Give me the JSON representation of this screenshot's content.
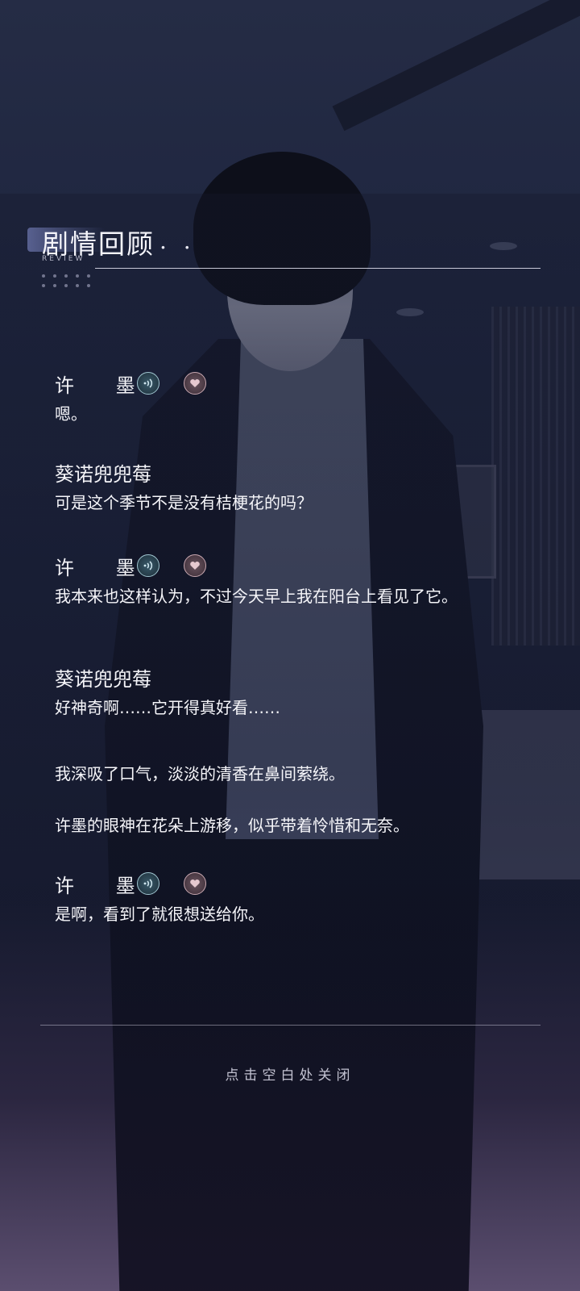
{
  "header": {
    "title": "剧情回顾",
    "title_dots": ". .",
    "subtitle": "REVIEW"
  },
  "dialogue": [
    {
      "speaker": "许 墨",
      "text": "嗯。",
      "has_voice": true,
      "has_like": true,
      "voice_icon": "sound-wave-icon",
      "like_icon": "heart-icon"
    },
    {
      "speaker": "葵诺兜兜莓",
      "text": "可是这个季节不是没有桔梗花的吗？",
      "has_voice": false,
      "has_like": false
    },
    {
      "speaker": "许 墨",
      "text": "我本来也这样认为，不过今天早上我在阳台上看见了它。",
      "has_voice": true,
      "has_like": true
    },
    {
      "speaker": "葵诺兜兜莓",
      "text": "好神奇啊……它开得真好看……",
      "has_voice": false,
      "has_like": false
    }
  ],
  "narration": [
    "我深吸了口气，淡淡的清香在鼻间萦绕。",
    "许墨的眼神在花朵上游移，似乎带着怜惜和无奈。"
  ],
  "last_line": {
    "speaker": "许 墨",
    "text": "是啊，看到了就很想送给你。"
  },
  "footer": {
    "close_hint": "点击空白处关闭"
  },
  "colors": {
    "voice_accent": "#9fc4cf",
    "like_accent": "#c7a7b0",
    "text": "#f6f6fa"
  }
}
